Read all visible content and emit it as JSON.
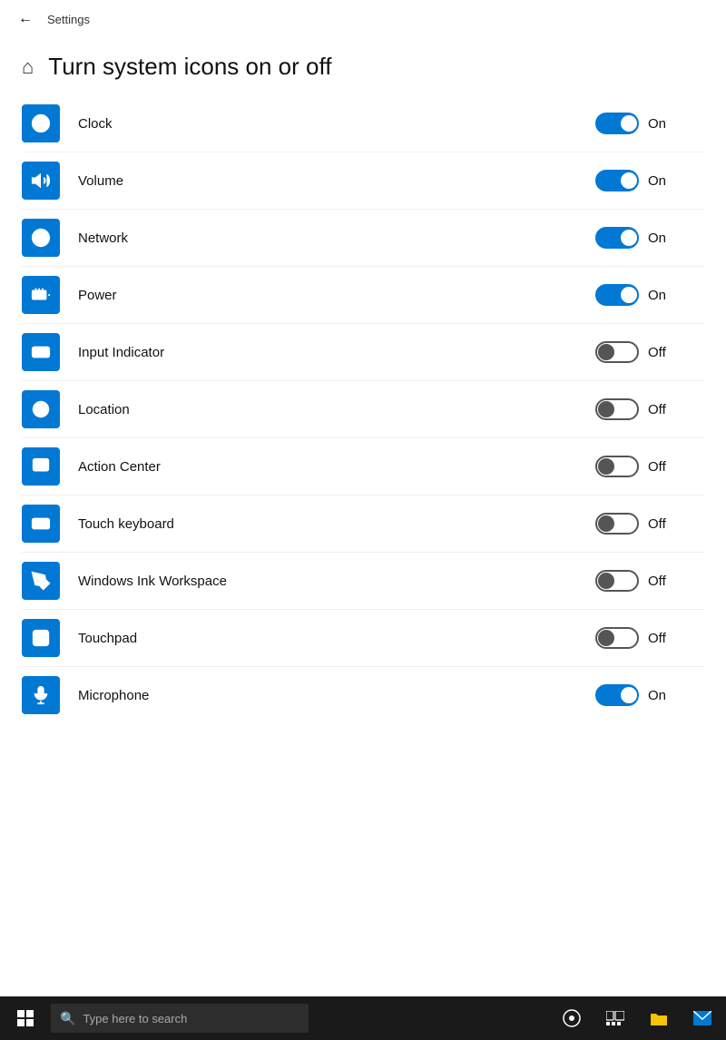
{
  "titleBar": {
    "backLabel": "←",
    "settingsLabel": "Settings"
  },
  "pageHeader": {
    "title": "Turn system icons on or off",
    "homeIcon": "⌂"
  },
  "settings": [
    {
      "id": "clock",
      "label": "Clock",
      "state": "on",
      "iconType": "clock"
    },
    {
      "id": "volume",
      "label": "Volume",
      "state": "on",
      "iconType": "volume"
    },
    {
      "id": "network",
      "label": "Network",
      "state": "on",
      "iconType": "network"
    },
    {
      "id": "power",
      "label": "Power",
      "state": "on",
      "iconType": "power"
    },
    {
      "id": "input-indicator",
      "label": "Input Indicator",
      "state": "off",
      "iconType": "input"
    },
    {
      "id": "location",
      "label": "Location",
      "state": "off",
      "iconType": "location"
    },
    {
      "id": "action-center",
      "label": "Action Center",
      "state": "off",
      "iconType": "action"
    },
    {
      "id": "touch-keyboard",
      "label": "Touch keyboard",
      "state": "off",
      "iconType": "keyboard"
    },
    {
      "id": "windows-ink",
      "label": "Windows Ink Workspace",
      "state": "off",
      "iconType": "ink"
    },
    {
      "id": "touchpad",
      "label": "Touchpad",
      "state": "off",
      "iconType": "touchpad"
    },
    {
      "id": "microphone",
      "label": "Microphone",
      "state": "on",
      "iconType": "microphone"
    }
  ],
  "taskbar": {
    "searchPlaceholder": "Type here to search",
    "startIcon": "⊞"
  }
}
